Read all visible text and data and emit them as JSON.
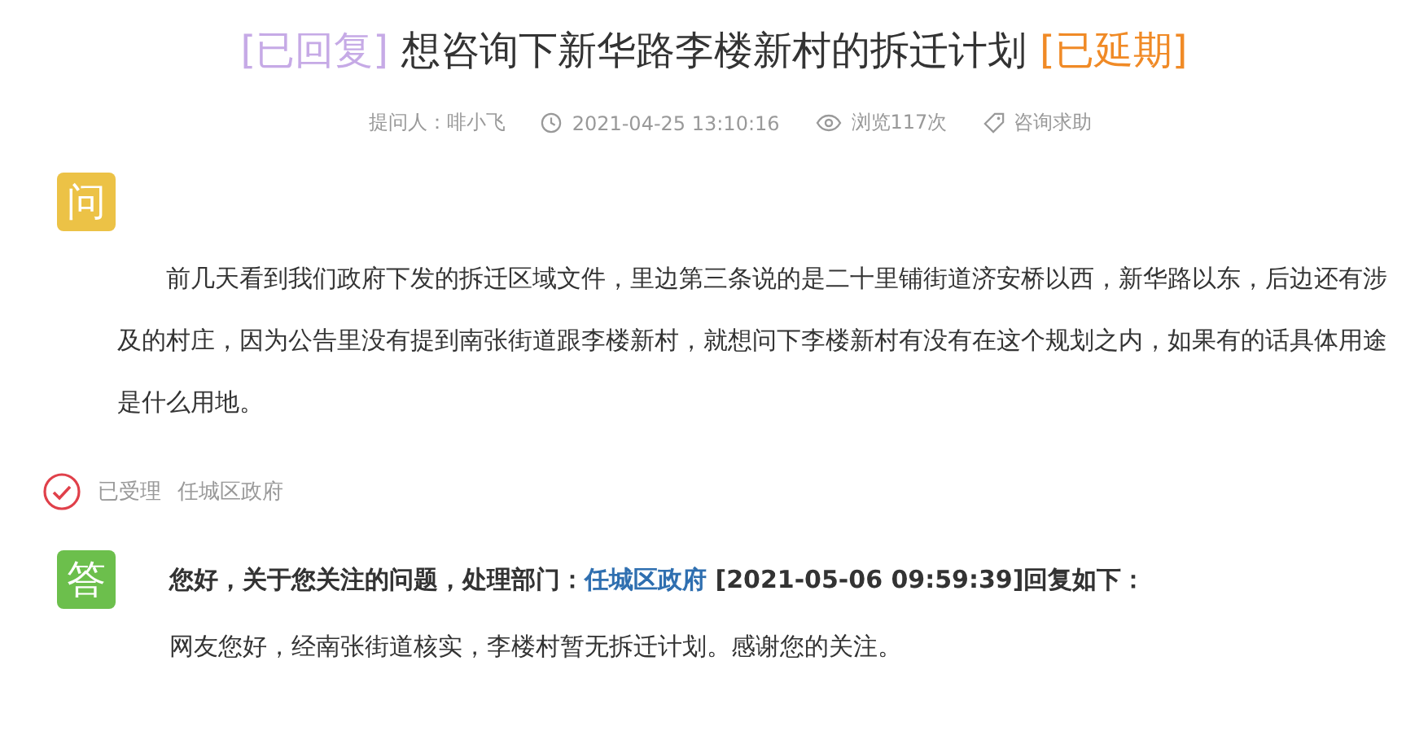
{
  "title": {
    "parts": [
      {
        "kind": "tag",
        "text": "[已回复]",
        "color": "#c6aae6"
      },
      {
        "kind": "text",
        "text": "想咨询下新华路李楼新村的拆迁计划"
      },
      {
        "kind": "tag",
        "text": "[已延期]",
        "color": "#f08a26"
      }
    ]
  },
  "meta": [
    {
      "kind": "asker",
      "text": "提问人：啡小飞"
    },
    {
      "kind": "time",
      "text": "2021-04-25 13:10:16"
    },
    {
      "kind": "views",
      "text": "浏览117次"
    },
    {
      "kind": "category",
      "text": "咨询求助"
    }
  ],
  "question": {
    "badge": "问",
    "text": "前几天看到我们政府下发的拆迁区域文件，里边第三条说的是二十里铺街道济安桥以西，新华路以东，后边还有涉及的村庄，因为公告里没有提到南张街道跟李楼新村，就想问下李楼新村有没有在这个规划之内，如果有的话具体用途是什么用地。"
  },
  "status": {
    "accepted": true,
    "label": "已受理",
    "department": "任城区政府"
  },
  "answer": {
    "badge": "答",
    "header_prefix": "您好，关于您关注的问题，处理部门：",
    "department_link": "任城区政府",
    "header_suffix": "[2021-05-06 09:59:39]回复如下：",
    "text": "网友您好，经南张街道核实，李楼村暂无拆迁计划。感谢您的关注。"
  }
}
